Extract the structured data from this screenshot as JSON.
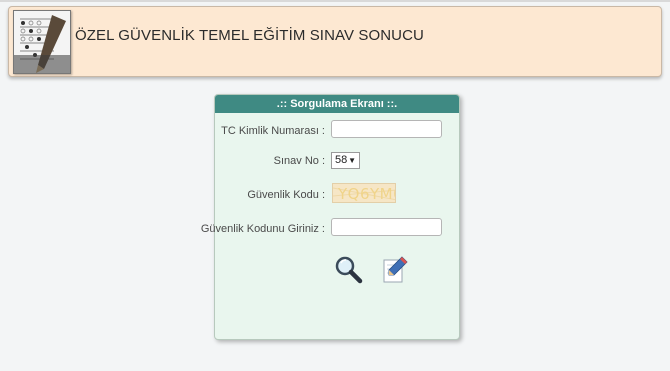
{
  "header": {
    "title": "ÖZEL GÜVENLİK TEMEL EĞİTİM SINAV SONUCU",
    "logo_icon": "exam-sheet-icon"
  },
  "form": {
    "title": ".:: Sorgulama Ekranı ::.",
    "tc_label": "TC Kimlik Numarası :",
    "tc_value": "",
    "sinav_label": "Sınav No :",
    "sinav_selected": "58",
    "guvenlik_label": "Güvenlik Kodu :",
    "captcha_text": "YQ6YM0",
    "kod_label": "Güvenlik Kodunu Giriniz :",
    "kod_value": "",
    "search_icon": "magnifier-icon",
    "clear_icon": "pencil-edit-icon"
  },
  "colors": {
    "header_bg": "#fde8d2",
    "panel_header": "#3f8a83",
    "panel_bg": "#e9f6ee",
    "captcha_bg": "#f6e6c6"
  }
}
